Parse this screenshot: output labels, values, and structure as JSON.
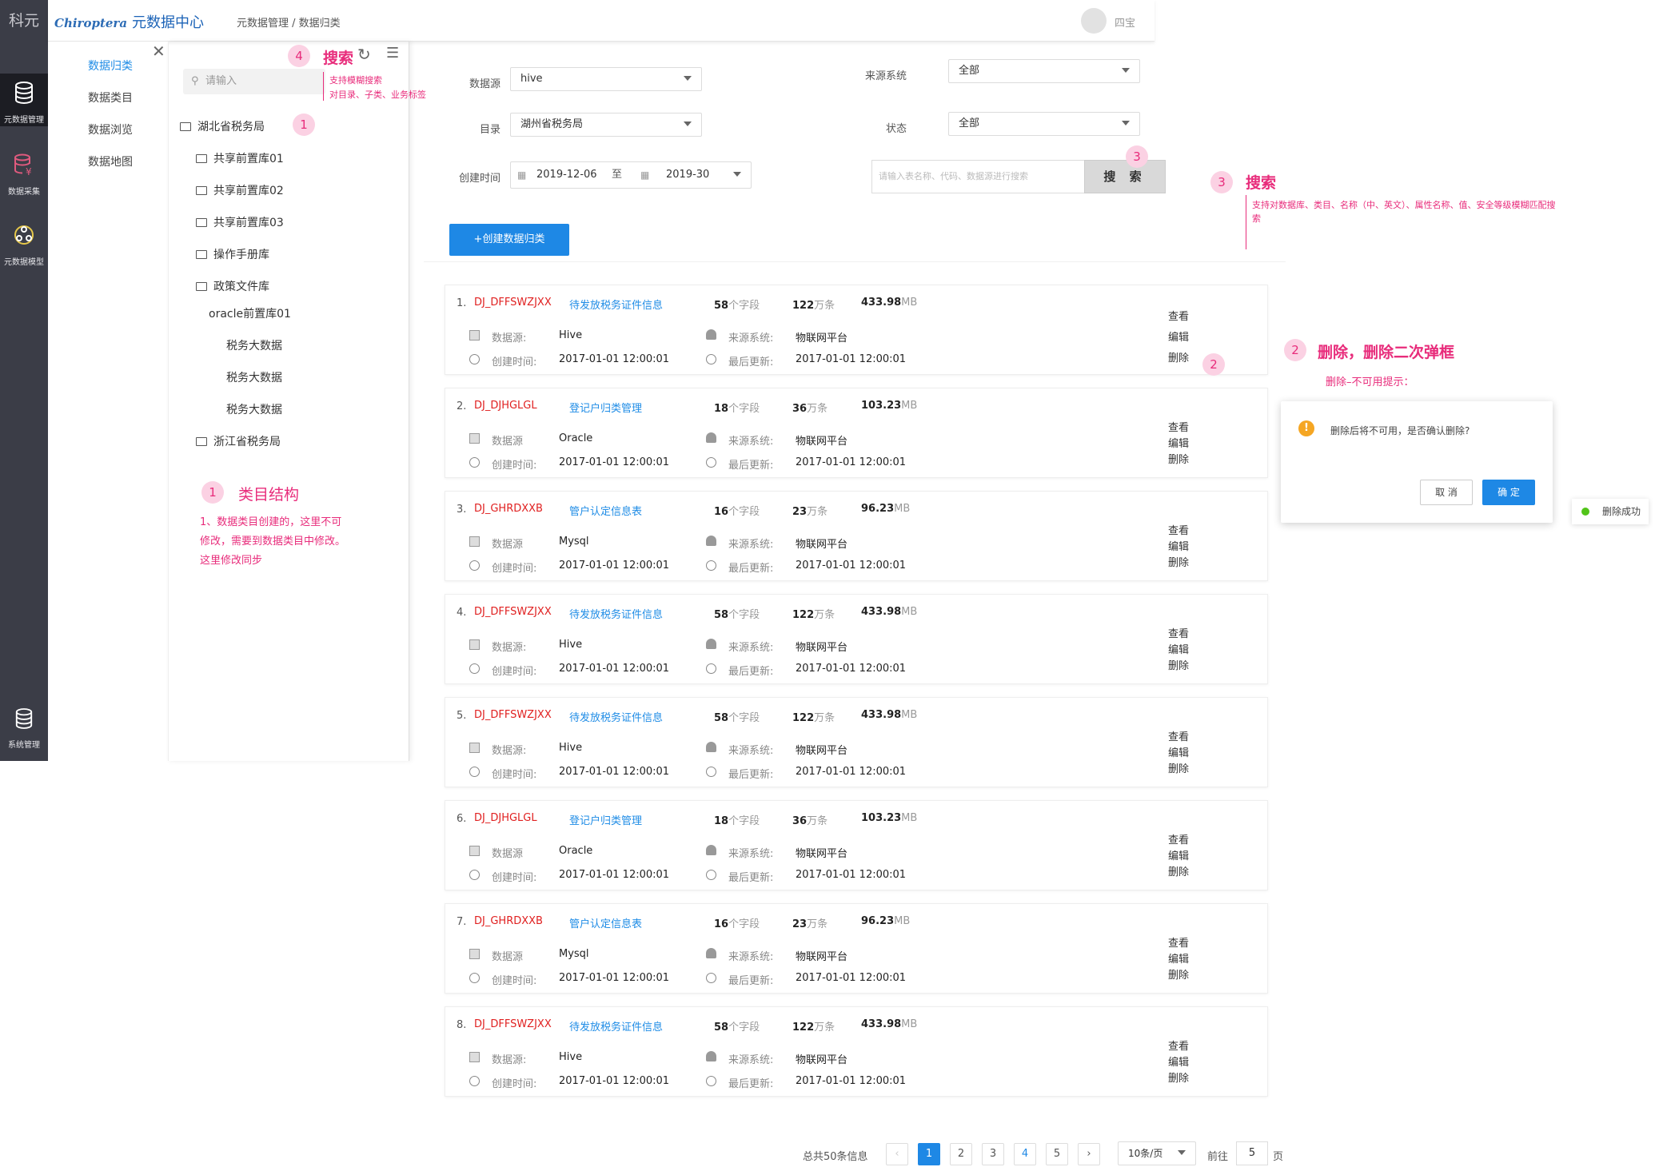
{
  "rail": {
    "logo": "科元",
    "items": [
      {
        "label": "元数据管理",
        "icon": "database-icon"
      },
      {
        "label": "数据采集",
        "icon": "data-collect-icon"
      },
      {
        "label": "元数据模型",
        "icon": "model-icon"
      },
      {
        "label": "系统管理",
        "icon": "database-icon"
      }
    ]
  },
  "header": {
    "brand_script": "Chiroptera",
    "brand_title": "元数据中心",
    "breadcrumb": "元数据管理 / 数据归类",
    "username": "四宝"
  },
  "menu": {
    "items": [
      "数据归类",
      "数据类目",
      "数据浏览",
      "数据地图"
    ],
    "active": "数据归类"
  },
  "tree": {
    "search_placeholder": "请输入",
    "nodes": [
      {
        "label": "湖北省税务局",
        "level": 0,
        "folder": true
      },
      {
        "label": "共享前置库01",
        "level": 1,
        "folder": true
      },
      {
        "label": "共享前置库02",
        "level": 1,
        "folder": true
      },
      {
        "label": "共享前置库03",
        "level": 1,
        "folder": true
      },
      {
        "label": "操作手册库",
        "level": 1,
        "folder": true
      },
      {
        "label": "政策文件库",
        "level": 1,
        "folder": true
      },
      {
        "label": "oracle前置库01",
        "level": 2,
        "folder": false
      },
      {
        "label": "税务大数据",
        "level": 3,
        "folder": false
      },
      {
        "label": "税务大数据",
        "level": 3,
        "folder": false
      },
      {
        "label": "税务大数据",
        "level": 3,
        "folder": false
      },
      {
        "label": "浙江省税务局",
        "level": 0,
        "folder": true
      }
    ]
  },
  "filters": {
    "datasource_label": "数据源",
    "datasource_value": "hive",
    "source_system_label": "来源系统",
    "source_system_value": "全部",
    "catalog_label": "目录",
    "catalog_value": "湖州省税务局",
    "status_label": "状态",
    "status_value": "全部",
    "created_label": "创建时间",
    "date_from": "2019-12-06",
    "date_sep": "至",
    "date_to": "2019-30",
    "search_placeholder": "请输入表名称、代码、数据源进行搜索",
    "search_button": "搜 索",
    "create_button": "+创建数据归类"
  },
  "labels": {
    "field_unit": "个字段",
    "count_unit": "万条",
    "size_unit": "MB",
    "created": "创建时间:",
    "updated": "最后更新:",
    "source_system": "来源系统:",
    "view": "查看",
    "edit": "编辑",
    "delete": "删除"
  },
  "records": [
    {
      "no": "1.",
      "code": "DJ_DFFSWZJXX",
      "name": "待发放税务证件信息",
      "fields": "58",
      "count": "122",
      "size": "433.98",
      "ds_label": "数据源:",
      "ds": "Hive",
      "system": "物联网平台",
      "created": "2017-01-01 12:00:01",
      "updated": "2017-01-01 12:00:01"
    },
    {
      "no": "2.",
      "code": "DJ_DJHGLGL",
      "name": "登记户归类管理",
      "fields": "18",
      "count": "36",
      "size": "103.23",
      "ds_label": "数据源",
      "ds": "Oracle",
      "system": "物联网平台",
      "created": "2017-01-01 12:00:01",
      "updated": "2017-01-01 12:00:01"
    },
    {
      "no": "3.",
      "code": "DJ_GHRDXXB",
      "name": "管户认定信息表",
      "fields": "16",
      "count": "23",
      "size": "96.23",
      "ds_label": "数据源",
      "ds": "Mysql",
      "system": "物联网平台",
      "created": "2017-01-01 12:00:01",
      "updated": "2017-01-01 12:00:01"
    },
    {
      "no": "4.",
      "code": "DJ_DFFSWZJXX",
      "name": "待发放税务证件信息",
      "fields": "58",
      "count": "122",
      "size": "433.98",
      "ds_label": "数据源:",
      "ds": "Hive",
      "system": "物联网平台",
      "created": "2017-01-01 12:00:01",
      "updated": "2017-01-01 12:00:01"
    },
    {
      "no": "5.",
      "code": "DJ_DFFSWZJXX",
      "name": "待发放税务证件信息",
      "fields": "58",
      "count": "122",
      "size": "433.98",
      "ds_label": "数据源:",
      "ds": "Hive",
      "system": "物联网平台",
      "created": "2017-01-01 12:00:01",
      "updated": "2017-01-01 12:00:01"
    },
    {
      "no": "6.",
      "code": "DJ_DJHGLGL",
      "name": "登记户归类管理",
      "fields": "18",
      "count": "36",
      "size": "103.23",
      "ds_label": "数据源",
      "ds": "Oracle",
      "system": "物联网平台",
      "created": "2017-01-01 12:00:01",
      "updated": "2017-01-01 12:00:01"
    },
    {
      "no": "7.",
      "code": "DJ_GHRDXXB",
      "name": "管户认定信息表",
      "fields": "16",
      "count": "23",
      "size": "96.23",
      "ds_label": "数据源",
      "ds": "Mysql",
      "system": "物联网平台",
      "created": "2017-01-01 12:00:01",
      "updated": "2017-01-01 12:00:01"
    },
    {
      "no": "8.",
      "code": "DJ_DFFSWZJXX",
      "name": "待发放税务证件信息",
      "fields": "58",
      "count": "122",
      "size": "433.98",
      "ds_label": "数据源:",
      "ds": "Hive",
      "system": "物联网平台",
      "created": "2017-01-01 12:00:01",
      "updated": "2017-01-01 12:00:01"
    }
  ],
  "pagination": {
    "total": "总共50条信息",
    "pages": [
      "1",
      "2",
      "3",
      "4",
      "5"
    ],
    "prev": "‹",
    "next": "›",
    "page_size": "10条/页",
    "goto_label": "前往",
    "goto_value": "5",
    "goto_suffix": "页"
  },
  "annotations": {
    "a1_num": "1",
    "a1_title": "类目结构",
    "a1_text": "1、数据类目创建的，这里不可修改，需要到数据类目中修改。这里修改同步",
    "a2_num": "2",
    "a2_title": "删除，删除二次弹框",
    "a2_text": "删除–不可用提示：",
    "a3_num": "3",
    "a3_title": "搜索",
    "a3_text": "支持对数据库、类目、名称（中、英文）、属性名称、值、安全等级模糊匹配搜索",
    "a4_num": "4",
    "a4_title": "搜索",
    "a4_text_1": "支持模糊搜索",
    "a4_text_2": "对目录、子类、业务标签"
  },
  "dialog": {
    "message": "删除后将不可用，是否确认删除?",
    "cancel": "取 消",
    "ok": "确 定",
    "warn_glyph": "!"
  },
  "toast": {
    "message": "删除成功"
  }
}
